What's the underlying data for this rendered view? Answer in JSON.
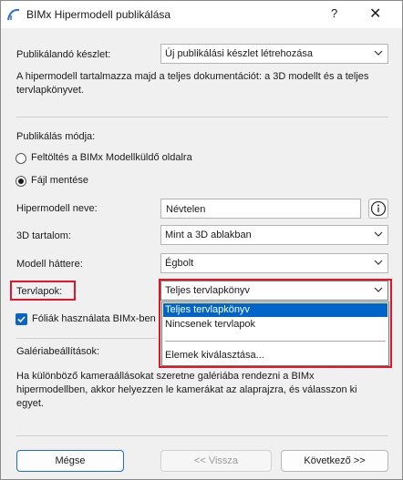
{
  "window": {
    "title": "BIMx Hipermodell publikálása",
    "help_label": "?",
    "close_label": "✕"
  },
  "publish_set": {
    "label": "Publikálandó készlet:",
    "value": "Új publikálási készlet létrehozása"
  },
  "description": "A hipermodell tartalmazza majd a teljes dokumentációt: a 3D modellt és a teljes tervlapkönyvet.",
  "publish_mode": {
    "label": "Publikálás módja:",
    "options": [
      {
        "label": "Feltöltés a BIMx Modellküldő oldalra",
        "selected": false
      },
      {
        "label": "Fájl mentése",
        "selected": true
      }
    ]
  },
  "hypermodel_name": {
    "label": "Hipermodell neve:",
    "value": "Névtelen",
    "info_icon": "info-icon"
  },
  "content_3d": {
    "label": "3D tartalom:",
    "value": "Mint a 3D ablakban"
  },
  "model_background": {
    "label": "Modell háttere:",
    "value": "Égbolt"
  },
  "layouts": {
    "label": "Tervlapok:",
    "value": "Teljes tervlapkönyv",
    "options": [
      "Teljes tervlapkönyv",
      "Nincsenek tervlapok",
      "Elemek kiválasztása..."
    ],
    "selected_index": 0
  },
  "sheets_checkbox": {
    "label": "Fóliák használata BIMx-ben",
    "checked": true
  },
  "gallery": {
    "label": "Galériabeállítások:",
    "text": "Ha különböző kameraállásokat szeretne galériába rendezni a BIMx hipermodellben, akkor helyezzen le kamerákat az alaprajzra, és válasszon ki egyet."
  },
  "buttons": {
    "cancel": "Mégse",
    "back": "<< Vissza",
    "next": "Következő >>"
  },
  "colors": {
    "highlight_red": "#e0162b",
    "selection_blue": "#0064c8",
    "checkbox_blue": "#0a64c8"
  }
}
